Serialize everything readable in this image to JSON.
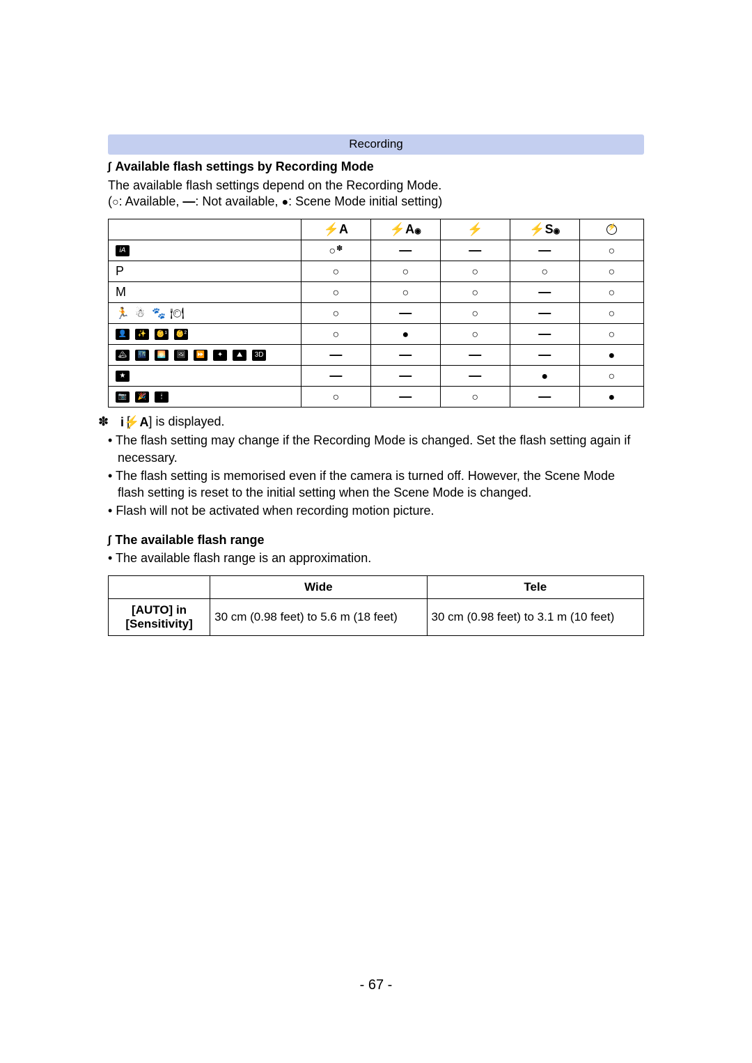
{
  "banner": "Recording",
  "section1": {
    "heading": "Available flash settings by Recording Mode",
    "intro": "The available flash settings depend on the Recording Mode.",
    "legend_prefix": "(",
    "legend_available": ": Available, ",
    "legend_notavailable": ": Not available, ",
    "legend_initial": ": Scene Mode initial setting)",
    "col_headers": [
      "flash-auto",
      "flash-auto-redeye",
      "flash-forced-on",
      "flash-slow-redeye",
      "flash-forced-off"
    ],
    "rows": [
      {
        "mode": "iA",
        "mode_style": "box",
        "vals": [
          "circle_star",
          "dash",
          "dash",
          "dash",
          "circle"
        ]
      },
      {
        "mode": "P",
        "mode_style": "plain",
        "vals": [
          "circle",
          "circle",
          "circle",
          "circle",
          "circle"
        ]
      },
      {
        "mode": "M",
        "mode_style": "plain",
        "vals": [
          "circle",
          "circle",
          "circle",
          "dash",
          "circle"
        ]
      },
      {
        "mode": "scene-group-1",
        "mode_style": "icons1",
        "vals": [
          "circle",
          "dash",
          "circle",
          "dash",
          "circle"
        ]
      },
      {
        "mode": "scene-group-portraits",
        "mode_style": "icons2",
        "vals": [
          "circle",
          "filled",
          "circle",
          "dash",
          "circle"
        ]
      },
      {
        "mode": "scene-group-landscapes",
        "mode_style": "icons3",
        "vals": [
          "dash",
          "dash",
          "dash",
          "dash",
          "filled"
        ]
      },
      {
        "mode": "scene-group-night-portrait",
        "mode_style": "icons4",
        "vals": [
          "dash",
          "dash",
          "dash",
          "filled",
          "circle"
        ]
      },
      {
        "mode": "scene-group-misc",
        "mode_style": "icons5",
        "vals": [
          "circle",
          "dash",
          "circle",
          "dash",
          "filled"
        ]
      }
    ]
  },
  "sym": {
    "circle": "○",
    "circle_sup": "✽",
    "dash": "—",
    "filled": "●",
    "square": "∫"
  },
  "footnote": {
    "star": "✽",
    "text_prefix": "[",
    "text_suffix": "] is displayed."
  },
  "notes": [
    "The flash setting may change if the Recording Mode is changed. Set the flash setting again if necessary.",
    "The flash setting is memorised even if the camera is turned off. However, the Scene Mode flash setting is reset to the initial setting when the Scene Mode is changed.",
    "Flash will not be activated when recording motion picture."
  ],
  "section2": {
    "heading": "The available flash range",
    "intro": "The available flash range is an approximation.",
    "table": {
      "headers": [
        "",
        "Wide",
        "Tele"
      ],
      "row_label_1": "[AUTO] in",
      "row_label_2": "[Sensitivity]",
      "wide": "30 cm (0.98 feet) to 5.6 m (18 feet)",
      "tele": "30 cm (0.98 feet) to 3.1 m (10 feet)"
    }
  },
  "page_number": "- 67 -"
}
